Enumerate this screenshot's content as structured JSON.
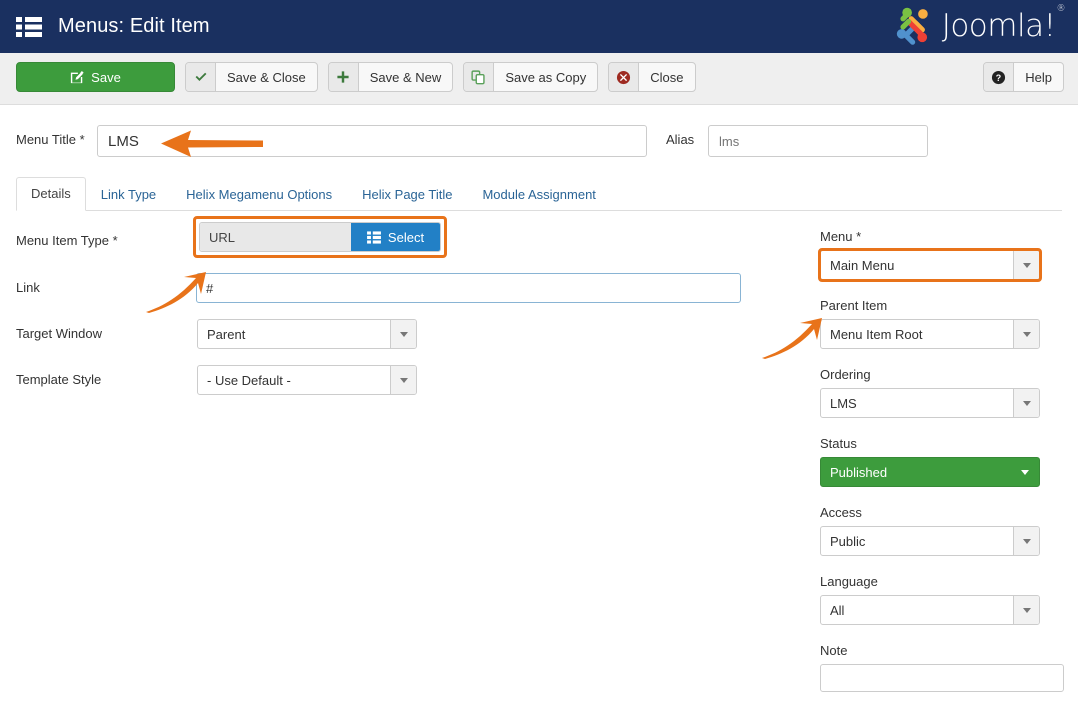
{
  "header": {
    "title": "Menus: Edit Item",
    "menu_icon": "list-menu-icon",
    "brand": "Joomla!",
    "brand_trademark": "®",
    "bg_color": "#1a3060"
  },
  "toolbar": {
    "save_label": "Save",
    "save_icon": "pencil-square-icon",
    "save_close_label": "Save & Close",
    "save_close_icon": "check-icon",
    "save_new_label": "Save & New",
    "save_new_icon": "plus-icon",
    "save_copy_label": "Save as Copy",
    "save_copy_icon": "copy-icon",
    "close_label": "Close",
    "close_icon": "circle-x-icon",
    "help_label": "Help",
    "help_icon": "question-circle-icon",
    "save_color": "#3d9c3d",
    "close_icon_color": "#9e2a21"
  },
  "form": {
    "menu_title_label": "Menu Title *",
    "menu_title_value": "LMS",
    "alias_label": "Alias",
    "alias_value": "lms",
    "alias_placeholder": "lms"
  },
  "tabs": [
    {
      "label": "Details",
      "active": true
    },
    {
      "label": "Link Type",
      "active": false
    },
    {
      "label": "Helix Megamenu Options",
      "active": false
    },
    {
      "label": "Helix Page Title",
      "active": false
    },
    {
      "label": "Module Assignment",
      "active": false
    }
  ],
  "details": {
    "menu_item_type_label": "Menu Item Type *",
    "menu_item_type_value": "URL",
    "select_button_label": "Select",
    "select_button_icon": "list-icon",
    "select_button_color": "#2280c6",
    "link_label": "Link",
    "link_value": "#",
    "target_window_label": "Target Window",
    "target_window_value": "Parent",
    "template_style_label": "Template Style",
    "template_style_value": "- Use Default -"
  },
  "sidebar": {
    "menu_label": "Menu *",
    "menu_value": "Main Menu",
    "parent_item_label": "Parent Item",
    "parent_item_value": "Menu Item Root",
    "ordering_label": "Ordering",
    "ordering_value": "LMS",
    "status_label": "Status",
    "status_value": "Published",
    "status_color": "#3d9c3d",
    "access_label": "Access",
    "access_value": "Public",
    "language_label": "Language",
    "language_value": "All",
    "note_label": "Note",
    "note_value": ""
  },
  "annotations": {
    "highlight_color": "#e8731a",
    "arrow_color": "#e8731a",
    "arrow_menu_title": "arrow-pointing-left-at-menu-title",
    "arrow_link": "arrow-pointing-up-right-at-link",
    "arrow_parent_item": "arrow-pointing-up-right-at-parent-item",
    "box_menu_item_type": "highlight-box-menu-item-type",
    "box_menu": "highlight-box-menu"
  }
}
